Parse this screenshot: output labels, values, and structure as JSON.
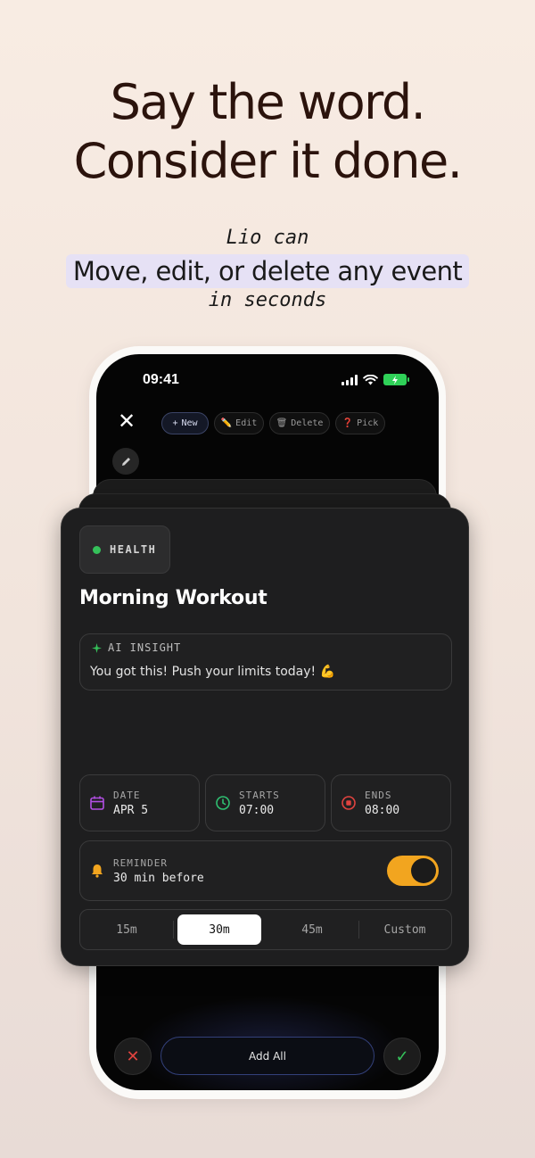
{
  "headline": {
    "line1": "Say the word.",
    "line2": "Consider it done."
  },
  "subheadline": {
    "prefix": "Lio can",
    "highlight": "Move, edit, or delete any event",
    "suffix": "in seconds"
  },
  "status_bar": {
    "time": "09:41"
  },
  "toolbar": {
    "chips": [
      {
        "icon": "+",
        "label": "New"
      },
      {
        "icon": "✏️",
        "label": "Edit"
      },
      {
        "icon": "🗑",
        "label": "Delete"
      },
      {
        "icon": "❓",
        "label": "Pick"
      }
    ]
  },
  "event": {
    "category": "HEALTH",
    "title": "Morning Workout",
    "insight": {
      "label": "AI INSIGHT",
      "text": "You got this! Push your limits today! 💪"
    },
    "date": {
      "label": "DATE",
      "value": "APR 5"
    },
    "starts": {
      "label": "STARTS",
      "value": "07:00"
    },
    "ends": {
      "label": "ENDS",
      "value": "08:00"
    },
    "reminder": {
      "label": "REMINDER",
      "value": "30 min before",
      "enabled": true
    },
    "reminder_options": [
      "15m",
      "30m",
      "45m",
      "Custom"
    ],
    "selected_option": "30m"
  },
  "bottom": {
    "add_all": "Add All"
  },
  "colors": {
    "health": "#35c15a",
    "date_icon": "#b24fe3",
    "starts_icon": "#2fbf71",
    "ends_icon": "#e0433f",
    "reminder_icon": "#f2a51f",
    "toggle_on": "#f2a51f",
    "cancel": "#e0433f",
    "confirm": "#35c15a"
  }
}
